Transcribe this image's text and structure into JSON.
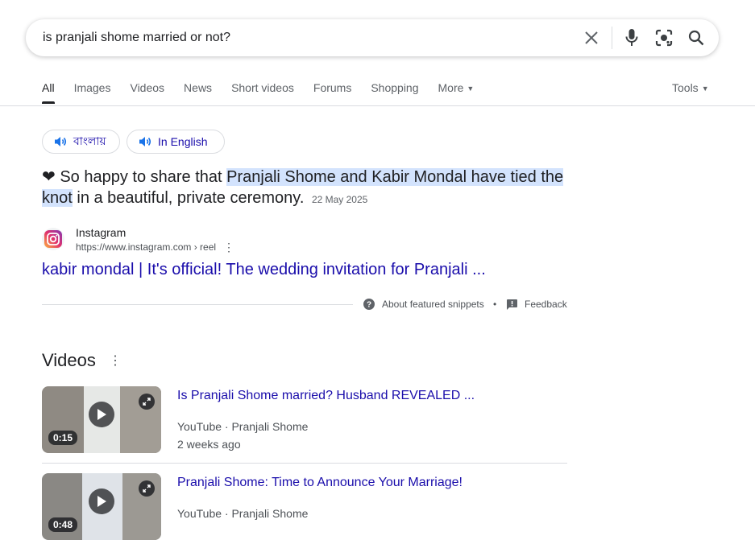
{
  "search": {
    "query": "is pranjali shome married or not?"
  },
  "tabs": [
    {
      "label": "All"
    },
    {
      "label": "Images"
    },
    {
      "label": "Videos"
    },
    {
      "label": "News"
    },
    {
      "label": "Short videos"
    },
    {
      "label": "Forums"
    },
    {
      "label": "Shopping"
    },
    {
      "label": "More"
    }
  ],
  "tools_label": "Tools",
  "language_pills": {
    "bengali": "বাংলায়",
    "english": "In English"
  },
  "snippet": {
    "prefix": "❤ So happy to share that ",
    "highlight": "Pranjali Shome and Kabir Mondal have tied the knot",
    "suffix": " in a beautiful, private ceremony.",
    "date": "22 May 2025"
  },
  "source": {
    "name": "Instagram",
    "url": "https://www.instagram.com › reel",
    "link_text": "kabir mondal | It's official! The wedding invitation for Pranjali ..."
  },
  "snippet_footer": {
    "about": "About featured snippets",
    "separator": "•",
    "feedback": "Feedback"
  },
  "videos": {
    "heading": "Videos",
    "items": [
      {
        "title": "Is Pranjali Shome married? Husband REVEALED ...",
        "platform": "YouTube",
        "channel": "Pranjali Shome",
        "date": "2 weeks ago",
        "duration": "0:15"
      },
      {
        "title": "Pranjali Shome: Time to Announce Your Marriage!",
        "platform": "YouTube",
        "channel": "Pranjali Shome",
        "date": "",
        "duration": "0:48"
      }
    ]
  },
  "colors": {
    "link": "#1a0dab",
    "highlight": "#d3e3fd",
    "muted": "#5f6368",
    "divider": "#dadce0"
  }
}
